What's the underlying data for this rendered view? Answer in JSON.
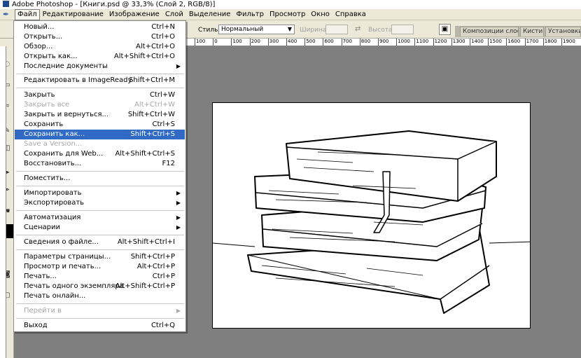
{
  "window": {
    "title": "Adobe Photoshop - [Книги.psd @ 33,3% (Слой 2, RGB/8)]"
  },
  "menubar": [
    {
      "label": "Файл",
      "active": true
    },
    {
      "label": "Редактирование"
    },
    {
      "label": "Изображение"
    },
    {
      "label": "Слой"
    },
    {
      "label": "Выделение"
    },
    {
      "label": "Фильтр"
    },
    {
      "label": "Просмотр"
    },
    {
      "label": "Окно"
    },
    {
      "label": "Справка"
    }
  ],
  "options": {
    "style_label": "Стиль:",
    "style_value": "Нормальный",
    "width_label": "Ширина:",
    "height_label": "Высота:"
  },
  "palette_tabs": [
    "Композиции слоев",
    "Кисти",
    "Установки и"
  ],
  "ruler_ticks": [
    "100",
    "0",
    "100",
    "200",
    "300",
    "400",
    "500",
    "600",
    "700",
    "800",
    "900",
    "1000",
    "1100",
    "1200",
    "1300",
    "1400",
    "1500",
    "1600",
    "1700",
    "1800",
    "1900"
  ],
  "file_menu": {
    "new": {
      "label": "Новый...",
      "shortcut": "Ctrl+N"
    },
    "open": {
      "label": "Открыть...",
      "shortcut": "Ctrl+O"
    },
    "browse": {
      "label": "Обзор...",
      "shortcut": "Alt+Ctrl+O"
    },
    "open_as": {
      "label": "Открыть как...",
      "shortcut": "Alt+Shift+Ctrl+O"
    },
    "recent": {
      "label": "Последние документы"
    },
    "edit_imageready": {
      "label": "Редактировать в ImageReady",
      "shortcut": "Shift+Ctrl+M"
    },
    "close": {
      "label": "Закрыть",
      "shortcut": "Ctrl+W"
    },
    "close_all": {
      "label": "Закрыть все",
      "shortcut": "Alt+Ctrl+W"
    },
    "close_return": {
      "label": "Закрыть и вернуться...",
      "shortcut": "Shift+Ctrl+W"
    },
    "save": {
      "label": "Сохранить",
      "shortcut": "Ctrl+S"
    },
    "save_as": {
      "label": "Сохранить как...",
      "shortcut": "Shift+Ctrl+S"
    },
    "save_version": {
      "label": "Save a Version..."
    },
    "save_web": {
      "label": "Сохранить для Web...",
      "shortcut": "Alt+Shift+Ctrl+S"
    },
    "revert": {
      "label": "Восстановить...",
      "shortcut": "F12"
    },
    "place": {
      "label": "Поместить..."
    },
    "import": {
      "label": "Импортировать"
    },
    "export": {
      "label": "Экспортировать"
    },
    "automate": {
      "label": "Автоматизация"
    },
    "scripts": {
      "label": "Сценарии"
    },
    "file_info": {
      "label": "Сведения о файле...",
      "shortcut": "Alt+Shift+Ctrl+I"
    },
    "page_setup": {
      "label": "Параметры страницы...",
      "shortcut": "Shift+Ctrl+P"
    },
    "print_preview": {
      "label": "Просмотр и печать...",
      "shortcut": "Alt+Ctrl+P"
    },
    "print": {
      "label": "Печать...",
      "shortcut": "Ctrl+P"
    },
    "print_one": {
      "label": "Печать одного экземпляра",
      "shortcut": "Alt+Shift+Ctrl+P"
    },
    "print_online": {
      "label": "Печать онлайн..."
    },
    "jump_to": {
      "label": "Перейти в"
    },
    "exit": {
      "label": "Выход",
      "shortcut": "Ctrl+Q"
    }
  },
  "colors": {
    "highlight": "#316ac5",
    "menu_bg": "#ece9d8",
    "workspace": "#7f7f7f"
  }
}
